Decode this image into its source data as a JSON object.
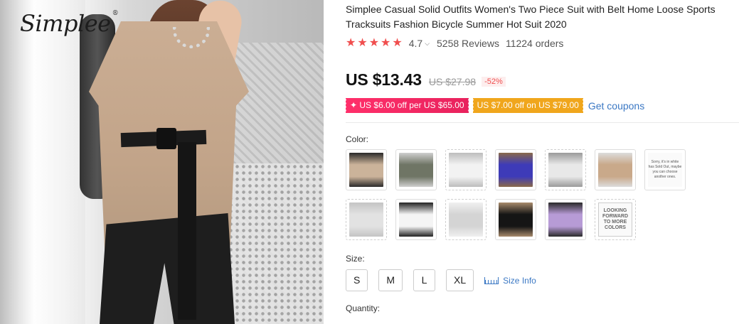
{
  "brand": {
    "logo": "Simplee",
    "reg": "®"
  },
  "product": {
    "title": "Simplee Casual Solid Outfits Women's Two Piece Suit with Belt Home Loose Sports Tracksuits Fashion Bicycle Summer Hot Suit 2020",
    "rating": "4.7",
    "rating_stars": 5,
    "reviews": "5258 Reviews",
    "orders": "11224 orders"
  },
  "price": {
    "current": "US $13.43",
    "original": "US $27.98",
    "discount": "-52%"
  },
  "coupons": [
    {
      "label": "✦ US $6.00 off per US $65.00",
      "color": "#ec2760"
    },
    {
      "label": "US $7.00 off on US $79.00",
      "color": "#f0a61c"
    }
  ],
  "get_coupons": "Get coupons",
  "color": {
    "label": "Color:",
    "swatches": [
      {
        "type": "photo",
        "colors": [
          "#cbb39a",
          "#2a2a2a"
        ]
      },
      {
        "type": "photo",
        "colors": [
          "#6f7565",
          "#cfcfcf"
        ]
      },
      {
        "type": "photo",
        "colors": [
          "#f2f2f2",
          "#bdbdbd"
        ]
      },
      {
        "type": "photo",
        "colors": [
          "#3e3bb8",
          "#8a6a4a"
        ]
      },
      {
        "type": "photo",
        "colors": [
          "#e8e8e8",
          "#9a9a9a"
        ]
      },
      {
        "type": "photo",
        "colors": [
          "#c9a98a",
          "#dcdcdc"
        ]
      },
      {
        "type": "text",
        "text": "Sorry, it's in white has Sold Out, maybe you can choose another ones."
      },
      {
        "type": "photo",
        "colors": [
          "#e2e2e2",
          "#c4c4c4"
        ]
      },
      {
        "type": "photo",
        "colors": [
          "#f4f4f4",
          "#222222"
        ]
      },
      {
        "type": "photo",
        "colors": [
          "#d4d4d4",
          "#f0f0f0"
        ]
      },
      {
        "type": "photo",
        "colors": [
          "#151515",
          "#a88a6c"
        ]
      },
      {
        "type": "photo",
        "colors": [
          "#b79bd6",
          "#2a2a2a"
        ]
      },
      {
        "type": "textbig",
        "text": "LOOKING FORWARD TO MORE COLORS"
      }
    ]
  },
  "size": {
    "label": "Size:",
    "options": [
      "S",
      "M",
      "L",
      "XL"
    ],
    "info": "Size Info"
  },
  "quantity": {
    "label": "Quantity:"
  }
}
